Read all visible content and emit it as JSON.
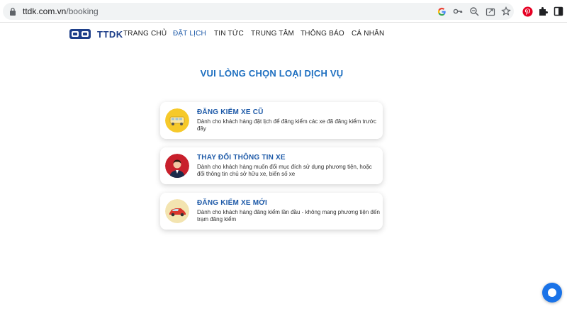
{
  "browser": {
    "url_host": "ttdk.com.vn",
    "url_path": "/booking"
  },
  "site": {
    "logo_text": "TTDK",
    "nav": [
      {
        "label": "TRANG CHỦ"
      },
      {
        "label": "ĐẶT LỊCH"
      },
      {
        "label": "TIN TỨC"
      },
      {
        "label": "TRUNG TÂM"
      },
      {
        "label": "THÔNG BÁO"
      },
      {
        "label": "CÁ NHÂN"
      }
    ],
    "active_color": "#1e5aa8"
  },
  "main": {
    "heading": "VUI LÒNG CHỌN LOẠI DỊCH VỤ",
    "services": [
      {
        "title": "ĐĂNG KIỂM XE CŨ",
        "desc": "Dành cho khách hàng đặt lịch để đăng kiểm các xe đã đăng kiểm trước đây",
        "icon": "old-car-icon"
      },
      {
        "title": "THAY ĐỔI THÔNG TIN XE",
        "desc": "Dành cho khách hàng muốn đổi mục đích sử dụng phương tiện, hoặc đổi thông tin chủ sở hữu xe, biển số xe",
        "icon": "owner-person-icon"
      },
      {
        "title": "ĐĂNG KIỂM XE MỚI",
        "desc": "Dành cho khách hàng đăng kiểm lần đầu - không mang phương tiện đến trạm đăng kiểm",
        "icon": "new-car-icon"
      }
    ]
  }
}
